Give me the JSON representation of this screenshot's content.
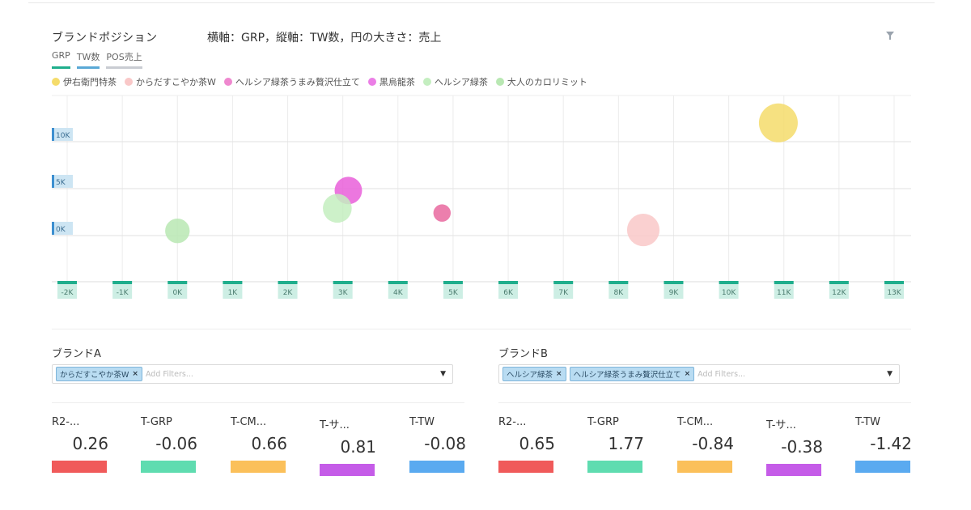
{
  "header": {
    "title": "ブランドポジション",
    "subtitle": "横軸：GRP，縦軸：TW数，円の大きさ：売上"
  },
  "tabs": [
    "GRP",
    "TW数",
    "POS売上"
  ],
  "legend": [
    {
      "label": "伊右衛門特茶",
      "color": "#f5dc6b"
    },
    {
      "label": "からだすこやか茶W",
      "color": "#f9c8c8"
    },
    {
      "label": "ヘルシア緑茶うまみ贅沢仕立て",
      "color": "#ef88cf"
    },
    {
      "label": "黒烏龍茶",
      "color": "#eb7ee6"
    },
    {
      "label": "ヘルシア緑茶",
      "color": "#c4eec0"
    },
    {
      "label": "大人のカロリミット",
      "color": "#b9e8b3"
    }
  ],
  "chart_data": {
    "type": "scatter",
    "xlabel": "GRP",
    "ylabel": "TW数",
    "xlim": [
      -2000,
      13000
    ],
    "ylim": [
      -5000,
      15000
    ],
    "x_ticks": [
      "-2K",
      "-1K",
      "0K",
      "1K",
      "2K",
      "3K",
      "4K",
      "5K",
      "6K",
      "7K",
      "8K",
      "9K",
      "10K",
      "11K",
      "12K",
      "13K"
    ],
    "x_tick_values": [
      -2000,
      -1000,
      0,
      1000,
      2000,
      3000,
      4000,
      5000,
      6000,
      7000,
      8000,
      9000,
      10000,
      11000,
      12000,
      13000
    ],
    "y_ticks": [
      "10K",
      "5K",
      "0K"
    ],
    "y_tick_values": [
      10000,
      5000,
      0
    ],
    "series": [
      {
        "name": "伊右衛門特茶",
        "color": "#f5dc6b",
        "x": 10900,
        "y": 12000,
        "size": 1.0
      },
      {
        "name": "からだすこやか茶W",
        "color": "#f9c8c8",
        "x": 8450,
        "y": 600,
        "size": 0.7
      },
      {
        "name": "ヘルシア緑茶うまみ贅沢仕立て",
        "color": "#e95fd9",
        "x": 3100,
        "y": 4800,
        "size": 0.5
      },
      {
        "name": "黒烏龍茶",
        "color": "#e9699f",
        "x": 4800,
        "y": 2400,
        "size": 0.2
      },
      {
        "name": "ヘルシア緑茶",
        "color": "#c4eec0",
        "x": 2900,
        "y": 2900,
        "size": 0.55
      },
      {
        "name": "大人のカロリミット",
        "color": "#b9e8b3",
        "x": 0,
        "y": 500,
        "size": 0.4
      }
    ]
  },
  "brandA": {
    "label": "ブランドA",
    "chips": [
      "からだすこやか茶W"
    ],
    "placeholder": "Add Filters...",
    "metrics": [
      {
        "label": "R2-...",
        "value": "0.26",
        "color": "#f05a5a"
      },
      {
        "label": "T-GRP",
        "value": "-0.06",
        "color": "#5fdcb0"
      },
      {
        "label": "T-CM...",
        "value": "0.66",
        "color": "#fbc05a"
      },
      {
        "label": "T-サ...",
        "value": "0.81",
        "color": "#c55ce8"
      },
      {
        "label": "T-TW",
        "value": "-0.08",
        "color": "#5aaaf0"
      }
    ]
  },
  "brandB": {
    "label": "ブランドB",
    "chips": [
      "ヘルシア緑茶",
      "ヘルシア緑茶うまみ贅沢仕立て"
    ],
    "placeholder": "Add Filters...",
    "metrics": [
      {
        "label": "R2-...",
        "value": "0.65",
        "color": "#f05a5a"
      },
      {
        "label": "T-GRP",
        "value": "1.77",
        "color": "#5fdcb0"
      },
      {
        "label": "T-CM...",
        "value": "-0.84",
        "color": "#fbc05a"
      },
      {
        "label": "T-サ...",
        "value": "-0.38",
        "color": "#c55ce8"
      },
      {
        "label": "T-TW",
        "value": "-1.42",
        "color": "#5aaaf0"
      }
    ]
  }
}
